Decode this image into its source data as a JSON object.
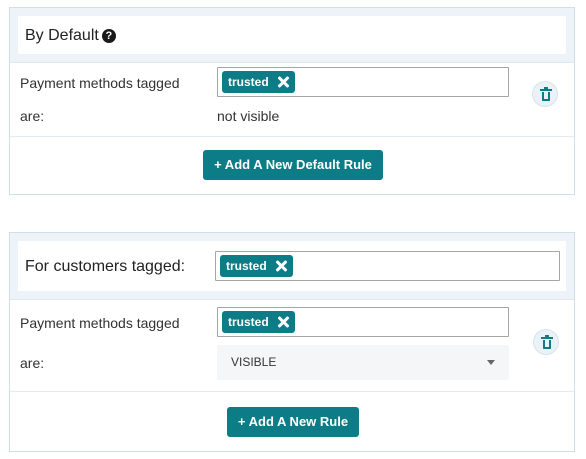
{
  "default_panel": {
    "title": "By Default",
    "help_icon": "question-circle-icon",
    "rule": {
      "label_line1": "Payment methods tagged",
      "label_line2": "are:",
      "tag": "trusted",
      "visibility": "not visible",
      "delete_icon": "trash-icon"
    },
    "add_button_label": "+ Add A New Default Rule"
  },
  "customer_panel": {
    "title": "For customers tagged:",
    "customer_tag": "trusted",
    "rule": {
      "label_line1": "Payment methods tagged",
      "label_line2": "are:",
      "tag": "trusted",
      "visibility_select": "VISIBLE",
      "delete_icon": "trash-icon"
    },
    "add_button_label": "+ Add A New Rule"
  },
  "colors": {
    "accent": "#0c7c86",
    "panel_border": "#cfdfea",
    "header_bg": "#edf3f8"
  }
}
